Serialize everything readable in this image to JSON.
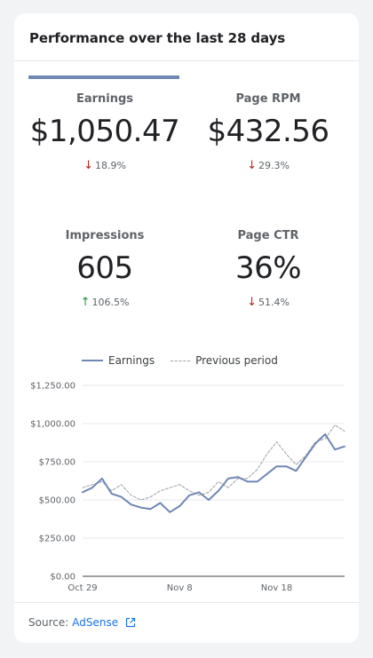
{
  "header": {
    "title": "Performance over the last 28 days"
  },
  "metrics": [
    {
      "label": "Earnings",
      "value": "$1,050.47",
      "change": "18.9%",
      "direction": "down",
      "arrow": "↓"
    },
    {
      "label": "Page RPM",
      "value": "$432.56",
      "change": "29.3%",
      "direction": "down",
      "arrow": "↓"
    },
    {
      "label": "Impressions",
      "value": "605",
      "change": "106.5%",
      "direction": "up",
      "arrow": "↑"
    },
    {
      "label": "Page CTR",
      "value": "36%",
      "change": "51.4%",
      "direction": "down",
      "arrow": "↓"
    }
  ],
  "legend": {
    "current": "Earnings",
    "previous": "Previous period"
  },
  "footer": {
    "source_label": "Source:",
    "source_link": "AdSense",
    "link_icon": "external-link-icon"
  },
  "colors": {
    "accent": "#6f87b5",
    "previous": "#9aa0a6",
    "down": "#b3261e",
    "up": "#1e8e3e"
  },
  "chart_data": {
    "type": "line",
    "x": [
      "Oct 29",
      "Oct 30",
      "Oct 31",
      "Nov 1",
      "Nov 2",
      "Nov 3",
      "Nov 4",
      "Nov 5",
      "Nov 6",
      "Nov 7",
      "Nov 8",
      "Nov 9",
      "Nov 10",
      "Nov 11",
      "Nov 12",
      "Nov 13",
      "Nov 14",
      "Nov 15",
      "Nov 16",
      "Nov 17",
      "Nov 18",
      "Nov 19",
      "Nov 20",
      "Nov 21",
      "Nov 22",
      "Nov 23",
      "Nov 24",
      "Nov 25"
    ],
    "x_ticks": [
      "Oct 29",
      "Nov 8",
      "Nov 18"
    ],
    "y_ticks": [
      "$0.00",
      "$250.00",
      "$500.00",
      "$750.00",
      "$1,000.00",
      "$1,250.00"
    ],
    "ylim": [
      0,
      1250
    ],
    "series": [
      {
        "name": "Earnings",
        "style": "solid",
        "values": [
          550,
          580,
          640,
          540,
          520,
          470,
          450,
          440,
          480,
          420,
          460,
          530,
          550,
          500,
          560,
          640,
          650,
          620,
          620,
          670,
          720,
          720,
          690,
          780,
          870,
          930,
          830,
          850
        ]
      },
      {
        "name": "Previous period",
        "style": "dashed",
        "values": [
          580,
          600,
          620,
          560,
          600,
          530,
          500,
          520,
          560,
          580,
          600,
          560,
          530,
          550,
          620,
          580,
          640,
          640,
          700,
          800,
          880,
          800,
          730,
          790,
          880,
          900,
          990,
          950
        ]
      }
    ],
    "grid": true,
    "legend_position": "top"
  }
}
